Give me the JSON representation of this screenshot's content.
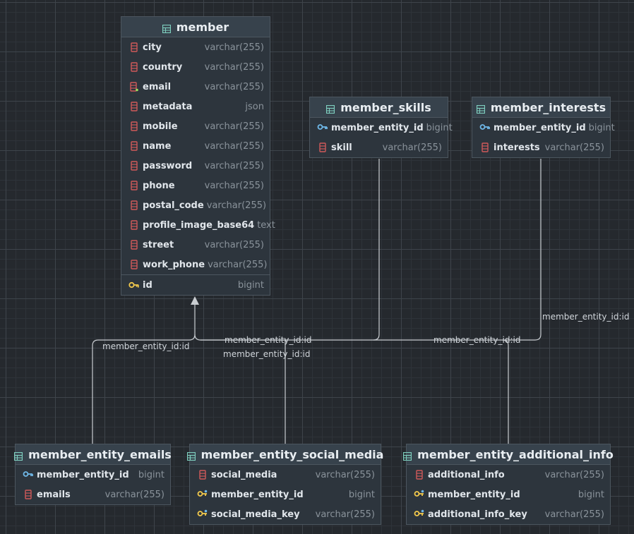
{
  "colors": {
    "background": "#25292e",
    "table_header": "#37424c",
    "table_body": "#2d353d",
    "table_border": "#4c565f",
    "column_icon": "#d05a5a",
    "pk_icon": "#f2c94c",
    "fk_icon": "#6fb8e8",
    "table_icon": "#7fd0c0",
    "link_line": "#c9cdd1"
  },
  "tables": {
    "member": {
      "title": "member",
      "columns": [
        {
          "name": "city",
          "type": "varchar(255)",
          "icon": "column-icon"
        },
        {
          "name": "country",
          "type": "varchar(255)",
          "icon": "column-icon"
        },
        {
          "name": "email",
          "type": "varchar(255)",
          "icon": "unique-column-icon"
        },
        {
          "name": "metadata",
          "type": "json",
          "icon": "column-icon"
        },
        {
          "name": "mobile",
          "type": "varchar(255)",
          "icon": "column-icon"
        },
        {
          "name": "name",
          "type": "varchar(255)",
          "icon": "column-icon"
        },
        {
          "name": "password",
          "type": "varchar(255)",
          "icon": "column-icon"
        },
        {
          "name": "phone",
          "type": "varchar(255)",
          "icon": "column-icon"
        },
        {
          "name": "postal_code",
          "type": "varchar(255)",
          "icon": "column-icon"
        },
        {
          "name": "profile_image_base64",
          "type": "text",
          "icon": "column-icon"
        },
        {
          "name": "street",
          "type": "varchar(255)",
          "icon": "column-icon"
        },
        {
          "name": "work_phone",
          "type": "varchar(255)",
          "icon": "column-icon"
        }
      ],
      "key": {
        "name": "id",
        "type": "bigint",
        "icon": "primary-key-icon"
      }
    },
    "member_skills": {
      "title": "member_skills",
      "columns": [
        {
          "name": "member_entity_id",
          "type": "bigint",
          "icon": "foreign-key-icon"
        },
        {
          "name": "skill",
          "type": "varchar(255)",
          "icon": "column-icon"
        }
      ]
    },
    "member_interests": {
      "title": "member_interests",
      "columns": [
        {
          "name": "member_entity_id",
          "type": "bigint",
          "icon": "foreign-key-icon"
        },
        {
          "name": "interests",
          "type": "varchar(255)",
          "icon": "column-icon"
        }
      ]
    },
    "member_entity_emails": {
      "title": "member_entity_emails",
      "columns": [
        {
          "name": "member_entity_id",
          "type": "bigint",
          "icon": "foreign-key-icon"
        },
        {
          "name": "emails",
          "type": "varchar(255)",
          "icon": "column-icon"
        }
      ]
    },
    "member_entity_social_media": {
      "title": "member_entity_social_media",
      "columns": [
        {
          "name": "social_media",
          "type": "varchar(255)",
          "icon": "column-icon"
        },
        {
          "name": "member_entity_id",
          "type": "bigint",
          "icon": "composite-key-icon"
        },
        {
          "name": "social_media_key",
          "type": "varchar(255)",
          "icon": "composite-key-icon"
        }
      ]
    },
    "member_entity_additional_info": {
      "title": "member_entity_additional_info",
      "columns": [
        {
          "name": "additional_info",
          "type": "varchar(255)",
          "icon": "column-icon"
        },
        {
          "name": "member_entity_id",
          "type": "bigint",
          "icon": "composite-key-icon"
        },
        {
          "name": "additional_info_key",
          "type": "varchar(255)",
          "icon": "composite-key-icon"
        }
      ]
    }
  },
  "relations": {
    "emails": "member_entity_id:id",
    "social_media": "member_entity_id:id",
    "skills": "member_entity_id:id",
    "additional_info": "member_entity_id:id",
    "interests": "member_entity_id:id"
  }
}
